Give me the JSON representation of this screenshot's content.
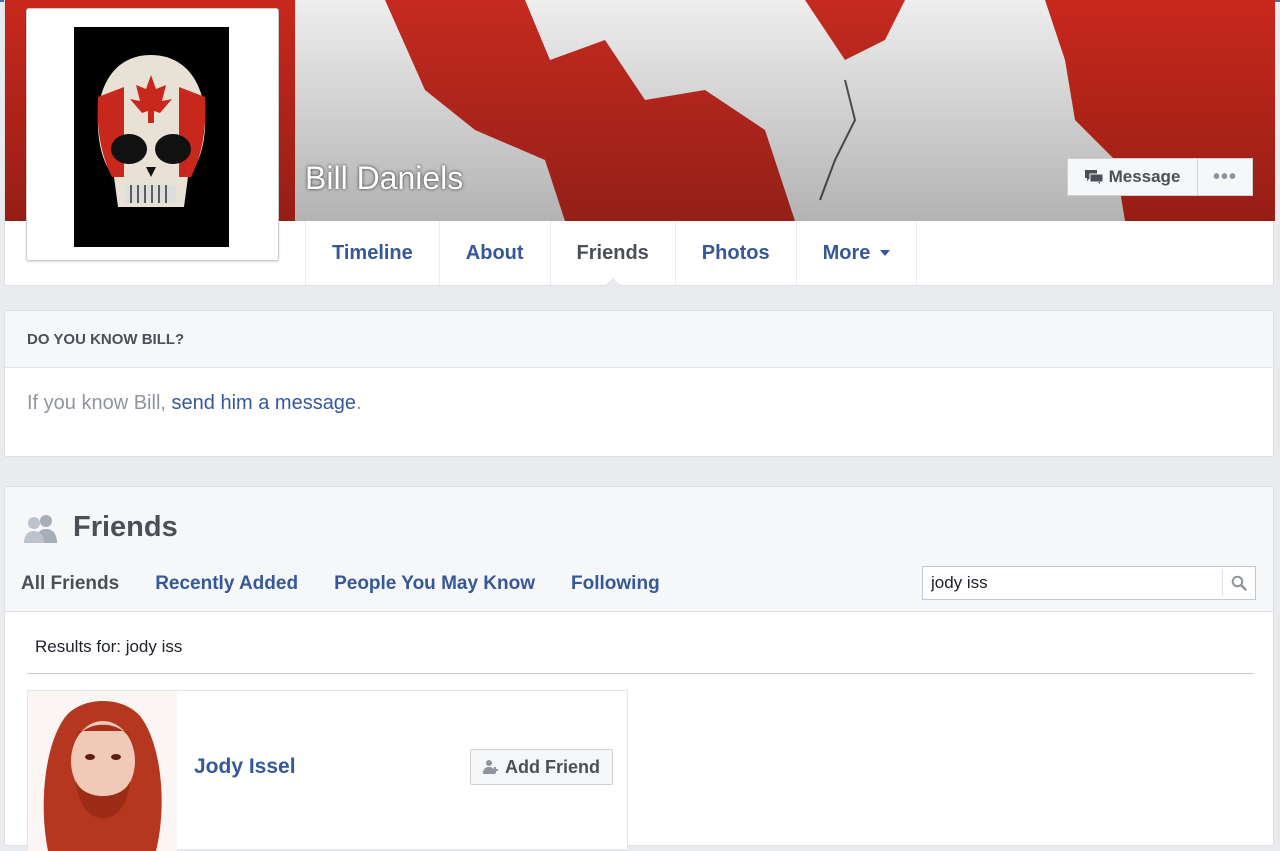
{
  "profile": {
    "name": "Bill Daniels",
    "message_button": "Message",
    "more_button": "•••"
  },
  "tabs": [
    {
      "label": "Timeline"
    },
    {
      "label": "About"
    },
    {
      "label": "Friends",
      "active": true
    },
    {
      "label": "Photos"
    },
    {
      "label": "More"
    }
  ],
  "know": {
    "heading": "DO YOU KNOW BILL?",
    "text_prefix": "If you know Bill, ",
    "link": "send him a message",
    "text_suffix": "."
  },
  "friends": {
    "title": "Friends",
    "subtabs": [
      {
        "label": "All Friends",
        "active": true
      },
      {
        "label": "Recently Added"
      },
      {
        "label": "People You May Know"
      },
      {
        "label": "Following"
      }
    ],
    "search_value": "jody iss",
    "results_label": "Results for: jody iss",
    "results": [
      {
        "name": "Jody Issel",
        "button": "Add Friend"
      }
    ]
  },
  "colors": {
    "link": "#365899",
    "text_dark": "#4b4f56",
    "background": "#e9ebee",
    "canada_red": "#d52b1e"
  }
}
